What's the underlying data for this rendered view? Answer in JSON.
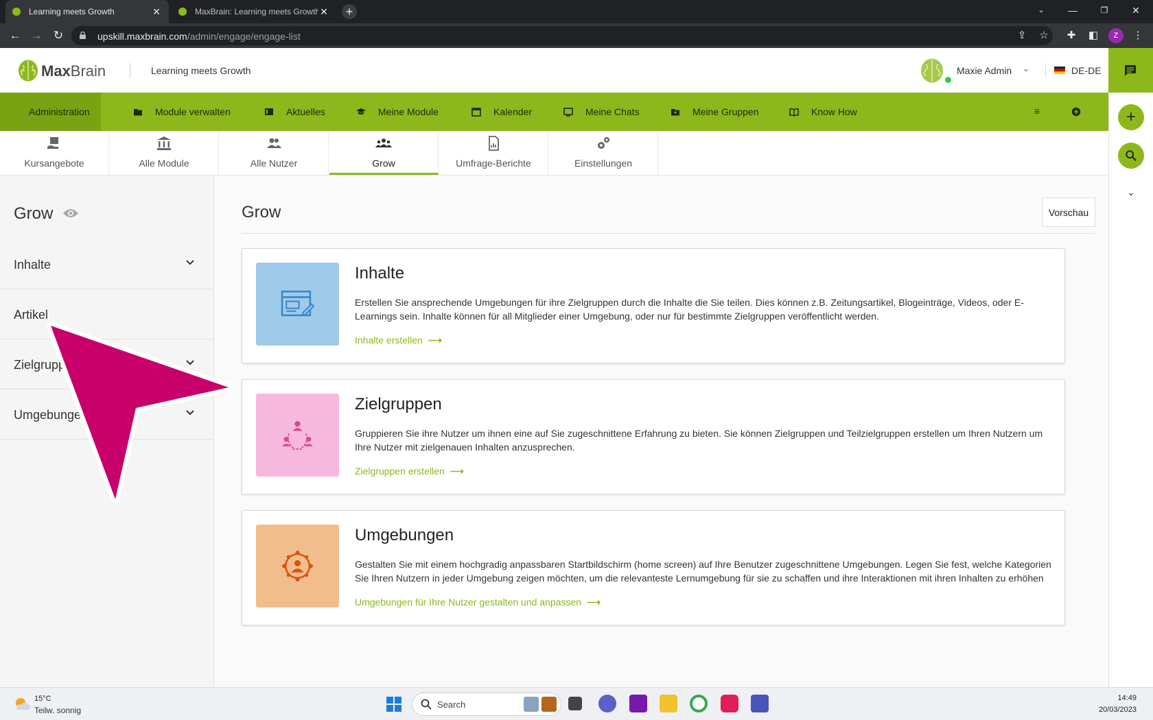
{
  "browser": {
    "tabs": [
      {
        "title": "Learning meets Growth",
        "active": true
      },
      {
        "title": "MaxBrain: Learning meets Growth",
        "active": false
      }
    ],
    "url_domain": "upskill.maxbrain.com",
    "url_path": "/admin/engage/engage-list",
    "profile_initial": "Z"
  },
  "header": {
    "logo_text_bold": "Max",
    "logo_text": "Brain",
    "subtitle": "Learning meets Growth",
    "user_name": "Maxie Admin",
    "language": "DE-DE"
  },
  "nav": {
    "items": [
      {
        "label": "Administration",
        "icon": "admin-icon",
        "active": true
      },
      {
        "label": "Module verwalten",
        "icon": "folder-icon"
      },
      {
        "label": "Aktuelles",
        "icon": "news-icon"
      },
      {
        "label": "Meine Module",
        "icon": "graduation-cap-icon"
      },
      {
        "label": "Kalender",
        "icon": "calendar-icon"
      },
      {
        "label": "Meine Chats",
        "icon": "chat-icon"
      },
      {
        "label": "Meine Gruppen",
        "icon": "group-folder-icon"
      },
      {
        "label": "Know How",
        "icon": "book-icon"
      }
    ]
  },
  "subtabs": [
    {
      "label": "Kursangebote",
      "icon": "hand-book-icon"
    },
    {
      "label": "Alle Module",
      "icon": "institution-icon"
    },
    {
      "label": "Alle Nutzer",
      "icon": "users-icon"
    },
    {
      "label": "Grow",
      "icon": "group-icon",
      "active": true
    },
    {
      "label": "Umfrage-Berichte",
      "icon": "report-icon"
    },
    {
      "label": "Einstellungen",
      "icon": "gears-icon"
    }
  ],
  "sidebar": {
    "title": "Grow",
    "items": [
      {
        "label": "Inhalte",
        "has_chevron": true
      },
      {
        "label": "Artikel",
        "has_chevron": false
      },
      {
        "label": "Zielgruppen",
        "has_chevron": true
      },
      {
        "label": "Umgebungen",
        "has_chevron": true
      }
    ]
  },
  "main": {
    "title": "Grow",
    "preview_label": "Vorschau",
    "cards": [
      {
        "title": "Inhalte",
        "description": "Erstellen Sie ansprechende Umgebungen für ihre Zielgruppen durch die Inhalte die Sie teilen. Dies können z.B. Zeitungsartikel, Blogeinträge, Videos, oder E-Learnings sein. Inhalte können für all Mitglieder einer Umgebung, oder nur für bestimmte Zielgruppen veröffentlicht werden.",
        "link": "Inhalte erstellen",
        "color": "#9fcbeb"
      },
      {
        "title": "Zielgruppen",
        "description": "Gruppieren Sie ihre Nutzer um ihnen eine auf Sie zugeschnittene Erfahrung zu bieten. Sie können Zielgruppen und Teilzielgruppen erstellen um Ihren Nutzern um Ihre Nutzer mit zielgenauen Inhalten anzusprechen.",
        "link": "Zielgruppen erstellen",
        "color": "#f7b8dd"
      },
      {
        "title": "Umgebungen",
        "description": "Gestalten Sie mit einem hochgradig anpassbaren Startbildschirm (home screen) auf Ihre Benutzer zugeschnittene Umgebungen. Legen Sie fest, welche Kategorien Sie Ihren Nutzern in jeder Umgebung zeigen möchten, um die relevanteste Lernumgebung für sie zu schaffen und ihre Interaktionen mit ihren Inhalten zu erhöhen",
        "link": "Umgebungen für Ihre Nutzer gestalten und anpassen",
        "color": "#f2bd8d"
      }
    ]
  },
  "taskbar": {
    "weather_temp": "15°C",
    "weather_desc": "Teilw. sonnig",
    "search_placeholder": "Search",
    "time": "14:49",
    "date": "20/03/2023"
  },
  "colors": {
    "brand_green": "#8db81c",
    "pointer": "#c8006a"
  }
}
